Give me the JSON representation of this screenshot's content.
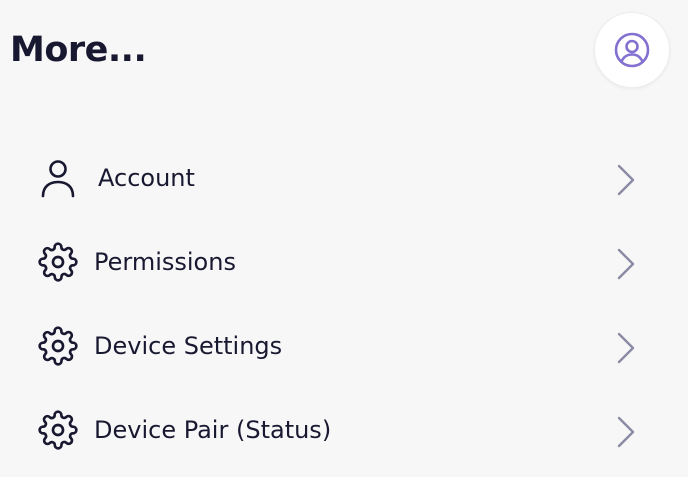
{
  "header": {
    "title": "More..."
  },
  "profile": {
    "icon": "user-circle-icon",
    "accent_color": "#8370d0"
  },
  "menu": {
    "items": [
      {
        "label": "Account",
        "icon": "user-icon"
      },
      {
        "label": "Permissions",
        "icon": "gear-icon"
      },
      {
        "label": "Device Settings",
        "icon": "gear-icon"
      },
      {
        "label": "Device Pair (Status)",
        "icon": "gear-icon"
      }
    ],
    "chevron_icon": "chevron-right-icon",
    "chevron_color": "#8a8aa3"
  }
}
